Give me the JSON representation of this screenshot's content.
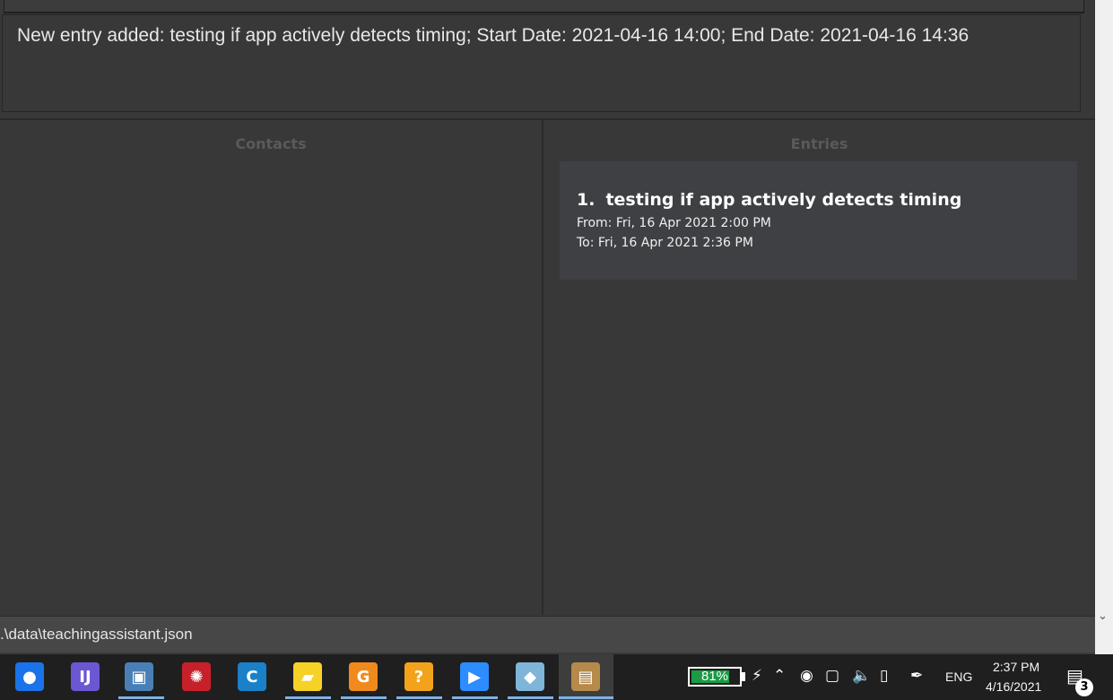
{
  "result": {
    "message": "New entry added: testing if app actively detects timing; Start Date: 2021-04-16 14:00; End Date: 2021-04-16 14:36"
  },
  "contacts_panel": {
    "title": "Contacts"
  },
  "entries_panel": {
    "title": "Entries",
    "entries": [
      {
        "index": "1.",
        "name": "testing if app actively detects timing",
        "from": "From: Fri, 16 Apr 2021 2:00 PM",
        "to": "To: Fri, 16 Apr 2021 2:36 PM"
      }
    ]
  },
  "status_bar": {
    "path": ".\\data\\teachingassistant.json"
  },
  "taskbar": {
    "apps": [
      {
        "name": "maps-app-icon",
        "glyph": "●",
        "color": "#1a73e8"
      },
      {
        "name": "intellij-icon",
        "glyph": "IJ",
        "color": "#6b57d2"
      },
      {
        "name": "virtualbox-icon",
        "glyph": "▣",
        "color": "#4a7fb5"
      },
      {
        "name": "antivirus-icon",
        "glyph": "✺",
        "color": "#c8202a"
      },
      {
        "name": "ccleaner-icon",
        "glyph": "C",
        "color": "#1a80c8"
      },
      {
        "name": "sticky-notes-icon",
        "glyph": "▰",
        "color": "#f7d226"
      },
      {
        "name": "pdf-app-icon",
        "glyph": "G",
        "color": "#f08a1c"
      },
      {
        "name": "file-tool-icon",
        "glyph": "?",
        "color": "#f2a31b"
      },
      {
        "name": "zoom-icon",
        "glyph": "▶",
        "color": "#2d8cff"
      },
      {
        "name": "notes-app-icon",
        "glyph": "◆",
        "color": "#7fb5d9"
      },
      {
        "name": "contacts-app-icon",
        "glyph": "▤",
        "color": "#b58a4a"
      }
    ],
    "battery_percent": "81%",
    "language": "ENG",
    "time": "2:37 PM",
    "date": "4/16/2021",
    "notification_count": "3"
  }
}
